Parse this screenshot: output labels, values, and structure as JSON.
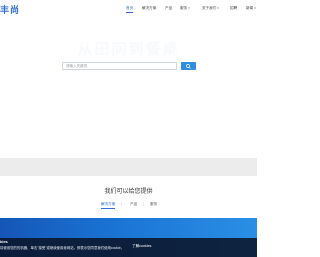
{
  "header": {
    "logo": "丰尚",
    "nav": [
      {
        "label": "首页",
        "active": true
      },
      {
        "label": "解决方案",
        "active": false
      },
      {
        "label": "产品",
        "active": false
      },
      {
        "label": "服务",
        "active": false,
        "dropdown": true
      },
      {
        "label": "关于我们",
        "active": false,
        "dropdown": true
      },
      {
        "label": "招聘",
        "active": false
      },
      {
        "label": "新闻",
        "active": false,
        "dropdown": true
      }
    ]
  },
  "hero": {
    "title": "从田间到餐桌",
    "search_placeholder": "请输入关键词",
    "search_icon": "search-icon"
  },
  "offer": {
    "title": "我们可以给您提供",
    "tabs": [
      {
        "label": "解决方案",
        "active": true
      },
      {
        "label": "产品",
        "active": false
      },
      {
        "label": "服务",
        "active": false
      }
    ]
  },
  "cookie": {
    "title": "kies",
    "text": "将使用您的的机器、单击\"接受\"或继续使用我网站，即表示您同意我们使用cookie。",
    "button": "了解cookies"
  },
  "colors": {
    "accent": "#2f6fd6",
    "search_button": "#2f8ee0",
    "banner": "#1a74d4"
  }
}
